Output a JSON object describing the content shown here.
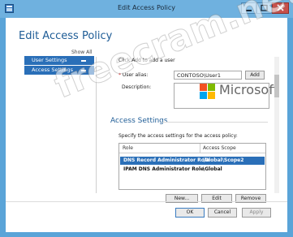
{
  "window": {
    "title": "Edit Access Policy",
    "controls": [
      "minimize",
      "maximize",
      "close"
    ]
  },
  "page": {
    "heading": "Edit Access Policy"
  },
  "nav": {
    "show_all": "Show All",
    "items": [
      {
        "label": "User Settings",
        "icon": "minus-icon"
      },
      {
        "label": "Access Settings",
        "icon": "minus-icon"
      }
    ]
  },
  "user_settings": {
    "instruction": "Click Add to add a user",
    "alias_label": "User alias:",
    "alias_value": "CONTOSO\\User1",
    "add_button": "Add",
    "description_label": "Description:"
  },
  "access_settings": {
    "title": "Access Settings",
    "instruction": "Specify the access settings for the access policy:",
    "columns": [
      "Role",
      "Access Scope"
    ],
    "rows": [
      {
        "role": "DNS Record Administrator Role",
        "scope": "\\Global\\Scope2",
        "selected": true
      },
      {
        "role": "IPAM DNS Administrator Role",
        "scope": "\\Global",
        "selected": false
      }
    ],
    "buttons": {
      "new": "New...",
      "edit": "Edit",
      "remove": "Remove"
    }
  },
  "footer": {
    "ok": "OK",
    "cancel": "Cancel",
    "apply": "Apply"
  },
  "overlay": {
    "logo_text": "Microsoft",
    "watermark": "freecram.net"
  },
  "colors": {
    "accent": "#2a6fb8",
    "heading": "#1e5c96",
    "frame": "#5aa4d8"
  }
}
